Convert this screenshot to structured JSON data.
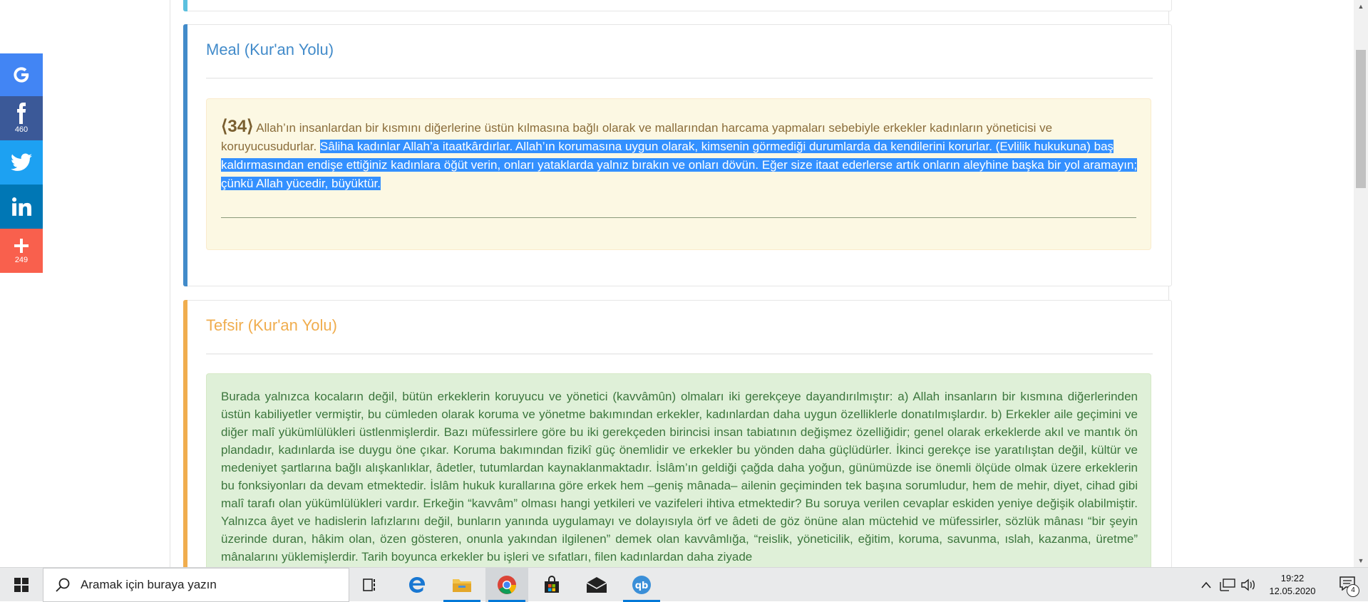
{
  "meal": {
    "title": "Meal (Kur'an Yolu)",
    "verse_number": "34",
    "text_unselected": " Allah’ın insanlardan bir kısmını diğerlerine üstün kılmasına bağlı olarak ve mallarından harcama yapmaları sebebiyle erkekler kadınların yöneticisi ve koruyucusudurlar. ",
    "text_selected": "Sâliha kadınlar Allah’a itaatkârdırlar. Allah’ın korumasına uygun olarak, kimsenin görmediği durumlarda da kendilerini korurlar. (Evlilik hukukuna) baş kaldırmasından endişe ettiğiniz kadınlara öğüt verin, onları yataklarda yalnız bırakın ve onları dövün. Eğer size itaat ederlerse artık onların aleyhine başka bir yol aramayın; çünkü Allah yücedir, büyüktür."
  },
  "tefsir": {
    "title": "Tefsir (Kur'an Yolu)",
    "text": "Burada yalnızca kocaların değil, bütün erkeklerin koruyucu ve yönetici (kavvâmûn) olmaları iki gerekçeye dayandırılmıştır: a) Allah insanların bir kısmına diğerlerinden üstün kabiliyetler vermiştir, bu cümleden olarak koruma ve yönetme bakımından erkekler, kadınlardan daha uygun özelliklerle donatılmışlardır. b) Erkekler aile geçimini ve diğer malî yükümlülükleri üstlenmişlerdir. Bazı müfessirlere göre bu iki gerekçeden birincisi insan tabiatının değişmez özelliğidir; genel olarak erkeklerde akıl ve mantık ön plandadır, kadınlarda ise duygu öne çıkar. Koruma bakımından fizikî güç önemlidir ve erkekler bu yönden daha güçlüdürler. İkinci gerekçe ise yaratılıştan değil, kültür ve medeniyet şartlarına bağlı alışkanlıklar, âdetler, tutumlardan kaynaklanmaktadır. İslâm’ın geldiği çağda daha yoğun, günümüzde ise önemli ölçüde olmak üzere erkeklerin bu fonksiyonları da devam etmektedir. İslâm hukuk kurallarına göre erkek hem –geniş mânada– ailenin geçiminden tek başına sorumludur, hem de mehir, diyet, cihad gibi malî tarafı olan yükümlülükleri vardır. Erkeğin “kavvâm” olması hangi yetkileri ve vazifeleri ihtiva etmektedir? Bu soruya verilen cevaplar eskiden yeniye değişik olabilmiştir. Yalnızca âyet ve hadislerin lafızlarını değil, bunların yanında uygulamayı ve dolayısıyla örf ve âdeti de göz önüne alan müctehid ve müfessirler, sözlük mânası “bir şeyin üzerinde duran, hâkim olan, özen gösteren, onunla yakından ilgilenen” demek olan kavvâmlığa, “reislik, yöneticilik, eğitim, koruma, savunma, ıslah, kazanma, üretme” mânalarını yüklemişlerdir. Tarih boyunca erkekler bu işleri ve sıfatları, filen kadınlardan daha ziyade"
  },
  "share": {
    "facebook_count": "460",
    "more_count": "249",
    "colors": {
      "google": "#4285f4",
      "facebook": "#3b5998",
      "twitter": "#1da1f2",
      "linkedin": "#0077b5",
      "more": "#f9604d"
    }
  },
  "taskbar": {
    "search_placeholder": "Aramak için buraya yazın",
    "time": "19:22",
    "date": "12.05.2020",
    "notification_count": "4",
    "apps": [
      "task-view-icon",
      "edge-icon",
      "file-explorer-icon",
      "chrome-icon",
      "store-icon",
      "mail-icon",
      "qbittorrent-icon"
    ]
  }
}
